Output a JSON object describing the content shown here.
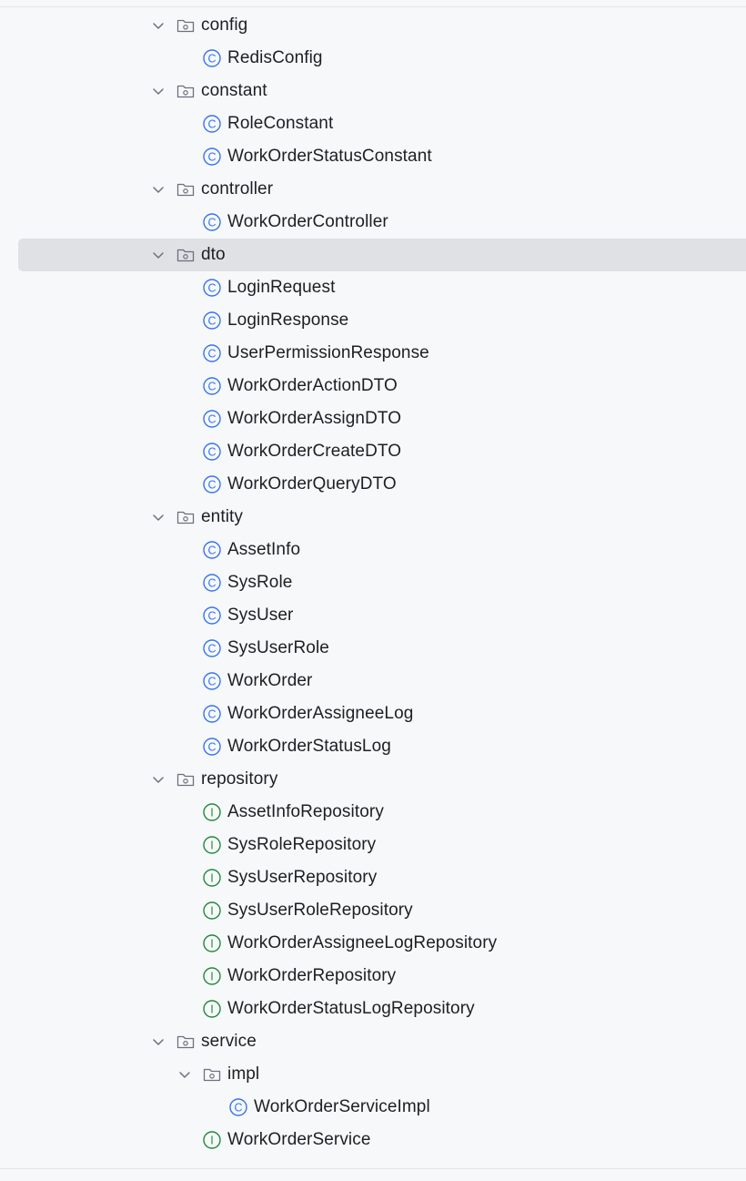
{
  "tree": [
    {
      "type": "folder",
      "label": "config",
      "indent": 0,
      "expanded": true
    },
    {
      "type": "class",
      "label": "RedisConfig",
      "indent": 1
    },
    {
      "type": "folder",
      "label": "constant",
      "indent": 0,
      "expanded": true
    },
    {
      "type": "class",
      "label": "RoleConstant",
      "indent": 1
    },
    {
      "type": "class",
      "label": "WorkOrderStatusConstant",
      "indent": 1
    },
    {
      "type": "folder",
      "label": "controller",
      "indent": 0,
      "expanded": true
    },
    {
      "type": "class",
      "label": "WorkOrderController",
      "indent": 1
    },
    {
      "type": "folder",
      "label": "dto",
      "indent": 0,
      "expanded": true,
      "selected": true
    },
    {
      "type": "class",
      "label": "LoginRequest",
      "indent": 1
    },
    {
      "type": "class",
      "label": "LoginResponse",
      "indent": 1
    },
    {
      "type": "class",
      "label": "UserPermissionResponse",
      "indent": 1
    },
    {
      "type": "class",
      "label": "WorkOrderActionDTO",
      "indent": 1
    },
    {
      "type": "class",
      "label": "WorkOrderAssignDTO",
      "indent": 1
    },
    {
      "type": "class",
      "label": "WorkOrderCreateDTO",
      "indent": 1
    },
    {
      "type": "class",
      "label": "WorkOrderQueryDTO",
      "indent": 1
    },
    {
      "type": "folder",
      "label": "entity",
      "indent": 0,
      "expanded": true
    },
    {
      "type": "class",
      "label": "AssetInfo",
      "indent": 1
    },
    {
      "type": "class",
      "label": "SysRole",
      "indent": 1
    },
    {
      "type": "class",
      "label": "SysUser",
      "indent": 1
    },
    {
      "type": "class",
      "label": "SysUserRole",
      "indent": 1
    },
    {
      "type": "class",
      "label": "WorkOrder",
      "indent": 1
    },
    {
      "type": "class",
      "label": "WorkOrderAssigneeLog",
      "indent": 1
    },
    {
      "type": "class",
      "label": "WorkOrderStatusLog",
      "indent": 1
    },
    {
      "type": "folder",
      "label": "repository",
      "indent": 0,
      "expanded": true
    },
    {
      "type": "interface",
      "label": "AssetInfoRepository",
      "indent": 1
    },
    {
      "type": "interface",
      "label": "SysRoleRepository",
      "indent": 1
    },
    {
      "type": "interface",
      "label": "SysUserRepository",
      "indent": 1
    },
    {
      "type": "interface",
      "label": "SysUserRoleRepository",
      "indent": 1
    },
    {
      "type": "interface",
      "label": "WorkOrderAssigneeLogRepository",
      "indent": 1
    },
    {
      "type": "interface",
      "label": "WorkOrderRepository",
      "indent": 1
    },
    {
      "type": "interface",
      "label": "WorkOrderStatusLogRepository",
      "indent": 1
    },
    {
      "type": "folder",
      "label": "service",
      "indent": 0,
      "expanded": true
    },
    {
      "type": "folder",
      "label": "impl",
      "indent": 1,
      "expanded": true
    },
    {
      "type": "class",
      "label": "WorkOrderServiceImpl",
      "indent": 2
    },
    {
      "type": "interface",
      "label": "WorkOrderService",
      "indent": 1
    },
    {
      "type": "folder",
      "label": "",
      "indent": 0,
      "expanded": false
    }
  ],
  "colors": {
    "class": "#3574f0",
    "interface": "#208a3c",
    "folder": "#6c707e",
    "chevron": "#6c707e",
    "selection": "#dfe1e5"
  },
  "icons": {
    "folder": "folder-icon",
    "class": "class-icon",
    "interface": "interface-icon",
    "expanded": "chevron-down-icon",
    "collapsed": "chevron-right-icon"
  }
}
